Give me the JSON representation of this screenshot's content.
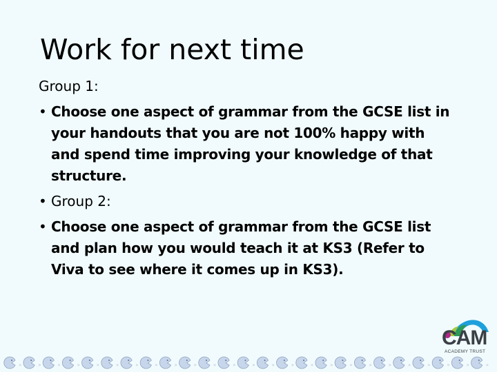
{
  "slide": {
    "title": "Work for next time",
    "group1_label": "Group 1:",
    "group1_task_lines": [
      "Choose one aspect of grammar from the GCSE list in",
      "your handouts that you are not 100% happy with",
      "and spend time improving your knowledge of that",
      "structure."
    ],
    "group2_label": "Group 2:",
    "group2_task_lines": [
      "Choose one aspect of grammar from the GCSE list",
      "and plan how you would teach it at KS3 (Refer to",
      "Viva to see where it comes up in KS3)."
    ]
  },
  "logo": {
    "name": "CAM",
    "subtitle": "ACADEMY TRUST",
    "colors": {
      "arc": "#1ea0dc",
      "green": "#2e9a57",
      "lime": "#a6c93c",
      "magenta": "#b0278c",
      "text": "#3b3f46"
    }
  },
  "footer": {
    "icon": "pacman-face-icon",
    "icon_count": 25,
    "icon_color": "#c7d6ea"
  },
  "colors": {
    "background": "#f1fbfd"
  }
}
